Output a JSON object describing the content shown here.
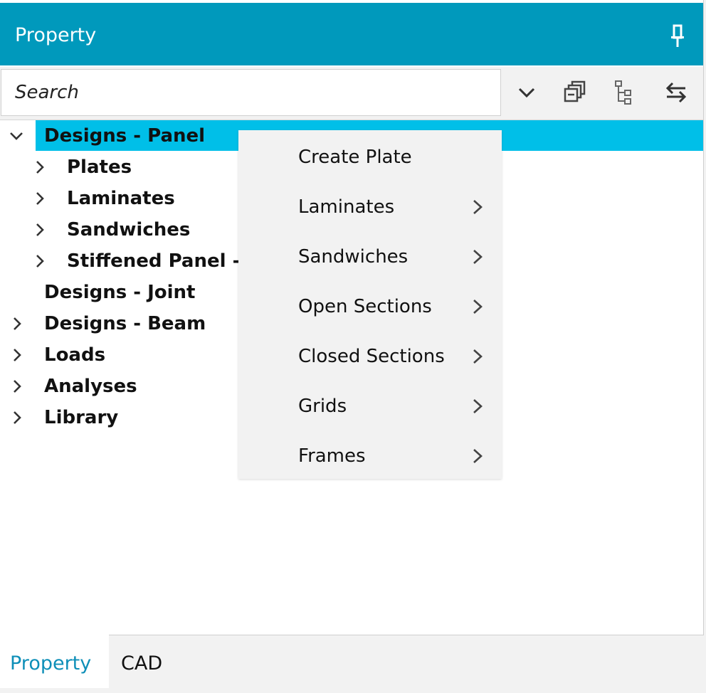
{
  "titlebar": {
    "title": "Property",
    "pin_icon": "pin-icon"
  },
  "search": {
    "placeholder": "Search",
    "tools": [
      "dropdown-chevron-icon",
      "collapse-all-icon",
      "tree-structure-icon",
      "sync-arrows-icon"
    ]
  },
  "tree": {
    "items": [
      {
        "label": "Designs - Panel",
        "level": 0,
        "expander": "expanded",
        "selected": true
      },
      {
        "label": "Plates",
        "level": 1,
        "expander": "collapsed"
      },
      {
        "label": "Laminates",
        "level": 1,
        "expander": "collapsed"
      },
      {
        "label": "Sandwiches",
        "level": 1,
        "expander": "collapsed"
      },
      {
        "label": "Stiffened Panel - C",
        "level": 1,
        "expander": "collapsed"
      },
      {
        "label": "Designs - Joint",
        "level": 0,
        "expander": "none"
      },
      {
        "label": "Designs - Beam",
        "level": 0,
        "expander": "collapsed"
      },
      {
        "label": "Loads",
        "level": 0,
        "expander": "collapsed"
      },
      {
        "label": "Analyses",
        "level": 0,
        "expander": "collapsed"
      },
      {
        "label": "Library",
        "level": 0,
        "expander": "collapsed"
      }
    ]
  },
  "context_menu": {
    "items": [
      {
        "label": "Create Plate",
        "submenu": false
      },
      {
        "label": "Laminates",
        "submenu": true
      },
      {
        "label": "Sandwiches",
        "submenu": true
      },
      {
        "label": "Open Sections",
        "submenu": true
      },
      {
        "label": "Closed Sections",
        "submenu": true
      },
      {
        "label": "Grids",
        "submenu": true
      },
      {
        "label": "Frames",
        "submenu": true
      }
    ]
  },
  "bottom_tabs": [
    {
      "label": "Property",
      "active": true
    },
    {
      "label": "CAD",
      "active": false
    }
  ],
  "colors": {
    "accent": "#0099bc",
    "selection": "#00bfe8",
    "active_tab_text": "#0e8fb8",
    "menu_bg": "#f2f2f2"
  }
}
